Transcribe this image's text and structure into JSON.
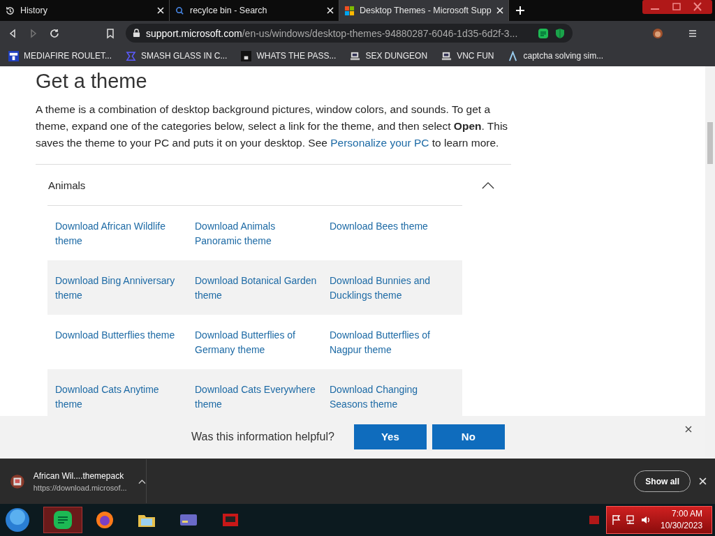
{
  "tabs": [
    {
      "label": "History",
      "selected": false
    },
    {
      "label": "recylce bin - Search",
      "selected": false
    },
    {
      "label": "Desktop Themes - Microsoft Supp",
      "selected": true
    }
  ],
  "toolbar": {
    "url_domain": "support.microsoft.com",
    "url_path": "/en-us/windows/desktop-themes-94880287-6046-1d35-6d2f-3..."
  },
  "bookmarks": [
    {
      "label": "MEDIAFIRE ROULET..."
    },
    {
      "label": "SMASH GLASS IN C..."
    },
    {
      "label": "WHATS THE PASS..."
    },
    {
      "label": "SEX DUNGEON"
    },
    {
      "label": "VNC FUN"
    },
    {
      "label": "captcha solving sim..."
    }
  ],
  "article": {
    "heading": "Get a theme",
    "text_before": "A theme is a combination of desktop background pictures, window colors, and sounds. To get a theme, expand one of the categories below, select a link for the theme, and then select **Open**. This saves the theme to your PC and puts it on your desktop. See ",
    "link": "Personalize your PC",
    "text_after": " to learn more.",
    "accordion": {
      "title": "Animals",
      "expanded": true,
      "rows": [
        [
          "Download African Wildlife theme",
          "Download Animals Panoramic theme",
          "Download Bees theme"
        ],
        [
          "Download Bing Anniversary theme",
          "Download Botanical Garden theme",
          "Download Bunnies and Ducklings theme"
        ],
        [
          "Download Butterflies theme",
          "Download Butterflies of Germany theme",
          "Download Butterflies of Nagpur theme"
        ],
        [
          "Download Cats Anytime theme",
          "Download Cats Everywhere theme",
          "Download Changing Seasons theme"
        ]
      ]
    }
  },
  "feedback": {
    "question": "Was this information helpful?",
    "buttons": [
      "Yes",
      "No"
    ]
  },
  "download": {
    "file": "African Wil....themepack",
    "url": "https://download.microsof...",
    "show_all": "Show all"
  },
  "taskbar": {
    "apps": [
      {
        "kind": "notes",
        "selected": true
      },
      {
        "kind": "firefox",
        "selected": false
      },
      {
        "kind": "folder",
        "selected": false
      },
      {
        "kind": "card",
        "selected": false
      },
      {
        "kind": "red",
        "selected": false
      }
    ],
    "time": "7:00 AM",
    "date": "10/30/2023"
  }
}
